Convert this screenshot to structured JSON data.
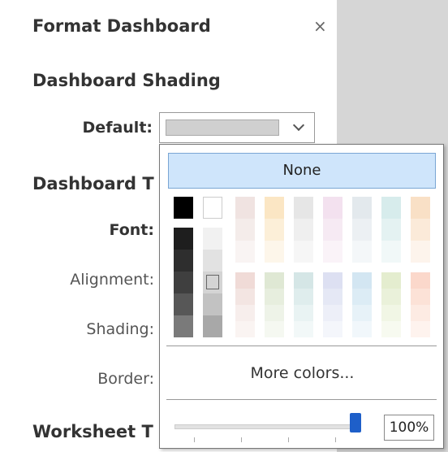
{
  "panel": {
    "title": "Format Dashboard",
    "close_glyph": "×",
    "dashboard_shading_title": "Dashboard Shading",
    "default_label": "Default:",
    "dashboard_title_section": "Dashboard T",
    "font_label": "Font:",
    "alignment_label": "Alignment:",
    "shading_label": "Shading:",
    "border_label": "Border:",
    "worksheet_title_section": "Worksheet T",
    "default_swatch_color": "#d0d0d0"
  },
  "picker": {
    "none_label": "None",
    "more_colors_label": "More colors...",
    "opacity_value": "100%",
    "opacity_fraction": 1.0,
    "top_colors": [
      "#000000",
      "#ffffff"
    ],
    "black_col": [
      "#1e1e1e",
      "#2e2e2e",
      "#3f3f3f",
      "#575757",
      "#7a7a7a"
    ],
    "gray_col": [
      "#f1f1f1",
      "#e2e2e2",
      "#d4d4d4",
      "#c2c2c2",
      "#a8a8a8"
    ],
    "group1_cols": [
      [
        "#f0e3e1",
        "#f4ecea",
        "#f9f4f3"
      ],
      [
        "#fbe6c4",
        "#fcefd8",
        "#fdf6ea"
      ],
      [
        "#e6e6e6",
        "#efefef",
        "#f6f6f6"
      ],
      [
        "#f3e1ef",
        "#f6eaf3",
        "#faf3f8"
      ],
      [
        "#e3e9ed",
        "#ecf0f3",
        "#f4f7f9"
      ],
      [
        "#d7ecec",
        "#e4f2f2",
        "#f1f8f8"
      ],
      [
        "#f9e0c6",
        "#fbead9",
        "#fdf4ec"
      ]
    ],
    "group2_cols": [
      [
        "#f0dbd7",
        "#f3e5e2",
        "#f7eeec",
        "#faf4f2"
      ],
      [
        "#dfe8d4",
        "#e7eede",
        "#eef3e8",
        "#f5f8f1"
      ],
      [
        "#d5e6e6",
        "#dfeded",
        "#e9f3f3",
        "#f2f8f8"
      ],
      [
        "#dde0f2",
        "#e5e8f5",
        "#edeff8",
        "#f4f6fb"
      ],
      [
        "#d3e6f2",
        "#dcecf5",
        "#e7f2f8",
        "#f1f7fb"
      ],
      [
        "#e4edcf",
        "#eaf1da",
        "#f1f6e5",
        "#f7faf0"
      ],
      [
        "#fbd8cb",
        "#fce2d7",
        "#fdebe3",
        "#fef3ee"
      ]
    ]
  }
}
